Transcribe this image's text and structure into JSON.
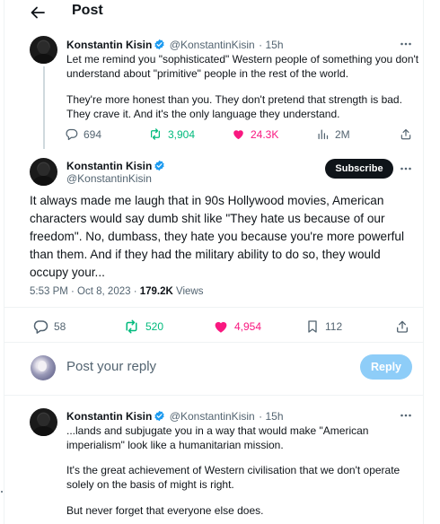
{
  "header": {
    "title": "Post"
  },
  "parent_tweet": {
    "author_name": "Konstantin Kisin",
    "author_handle": "@KonstantinKisin",
    "time": "· 15h",
    "line1": "Let me remind you \"sophisticated\" Western people of something you don't",
    "line2": "understand about \"primitive\" people in the rest of the world.",
    "line3": "They're more honest than you. They don't pretend that strength is bad.",
    "line4": "They crave it. And it's the only language they understand.",
    "replies": "694",
    "reposts": "3,904",
    "likes": "24.3K",
    "views": "2M"
  },
  "main_tweet": {
    "author_name": "Konstantin Kisin",
    "author_handle": "@KonstantinKisin",
    "subscribe_label": "Subscribe",
    "text_line1": "It always made me laugh that in 90s Hollywood movies, American",
    "text_line2": "characters would say dumb shit like \"They hate us because of our",
    "text_line3": "freedom\". No, dumbass, they hate you because you're more powerful",
    "text_line4": "than them. And if they had the military ability to do so, they would",
    "text_line5": "occupy your...",
    "timestamp": "5:53 PM · Oct 8, 2023 · ",
    "views_count": "179.2K",
    "views_label": " Views",
    "replies": "58",
    "reposts": "520",
    "likes": "4,954",
    "bookmarks": "112"
  },
  "composer": {
    "placeholder": "Post your reply",
    "reply_label": "Reply"
  },
  "reply_tweet": {
    "author_name": "Konstantin Kisin",
    "author_handle": "@KonstantinKisin",
    "time": "· 15h",
    "line1": "...lands and subjugate you in a way that would make \"American",
    "line2": "imperialism\" look like a humanitarian mission.",
    "line3": "It's the great achievement of Western civilisation that we don't operate",
    "line4": "solely on the basis of might is right.",
    "line5": "But never forget that everyone else does."
  },
  "colors": {
    "verified": "#1d9bf0",
    "like_active": "#f91880",
    "repost_green": "#00ba7c",
    "reply_button": "#8ecdf8"
  }
}
